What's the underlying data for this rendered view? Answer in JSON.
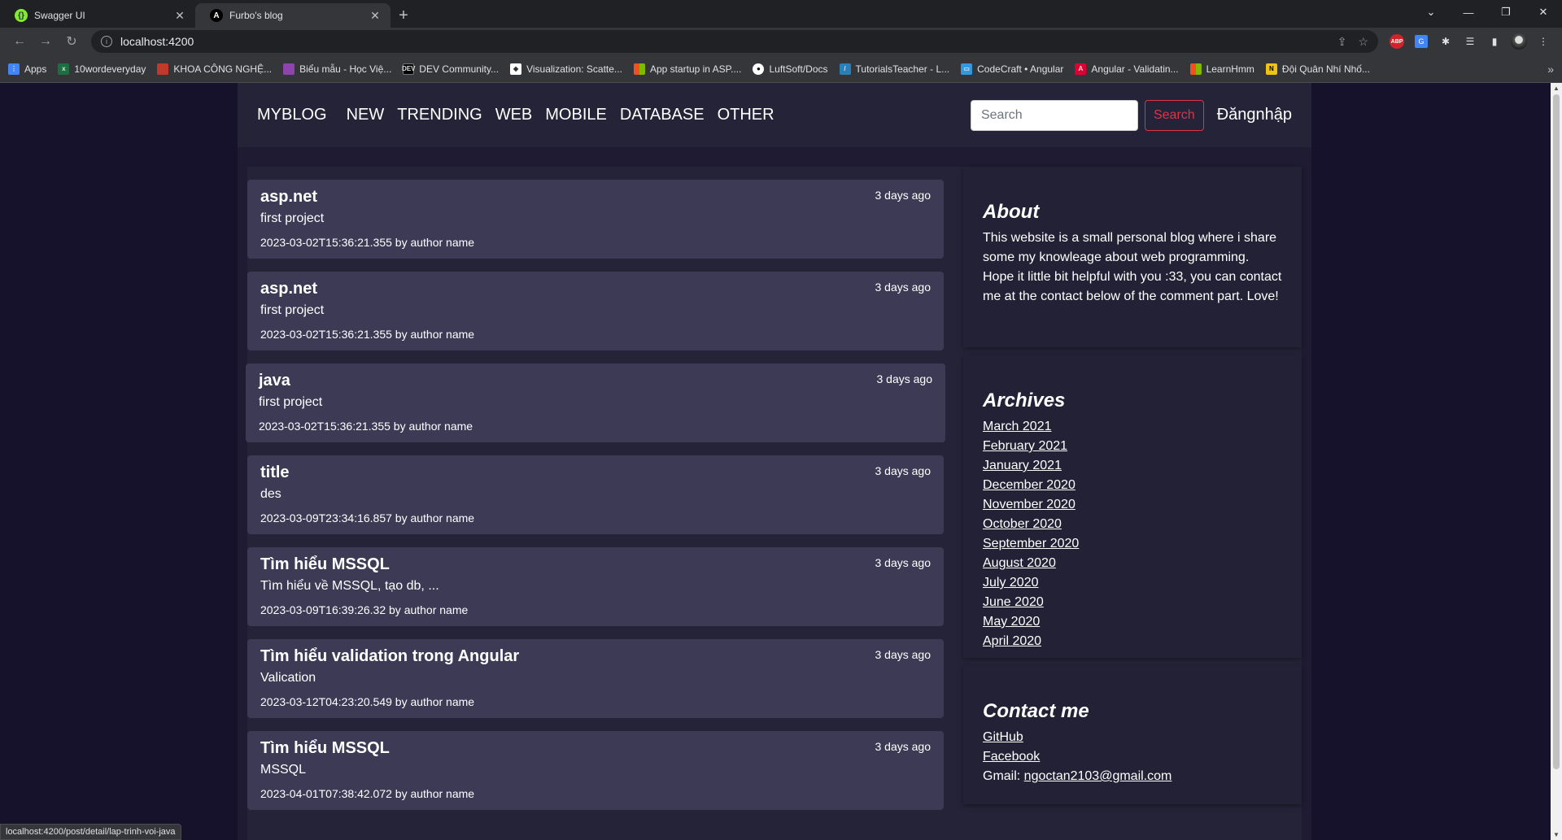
{
  "browser": {
    "tabs": [
      {
        "title": "Swagger UI",
        "favicon": "swagger-icon",
        "color": "#85ea2d"
      },
      {
        "title": "Furbo's blog",
        "favicon": "angular-icon",
        "color": "#ffffff"
      }
    ],
    "url": "localhost:4200",
    "bookmarks": [
      {
        "label": "Apps",
        "icon": "apps-icon",
        "color": "#4285f4"
      },
      {
        "label": "10wordeveryday",
        "icon": "excel-icon",
        "color": "#1d6f42"
      },
      {
        "label": "KHOA CÔNG NGHỆ...",
        "icon": "site-icon",
        "color": "#c0392b"
      },
      {
        "label": "Biểu mẫu - Học Việ...",
        "icon": "site-icon",
        "color": "#8e44ad"
      },
      {
        "label": "DEV Community...",
        "icon": "dev-icon",
        "color": "#000000"
      },
      {
        "label": "Visualization: Scatte...",
        "icon": "chart-icon",
        "color": "#ffffff"
      },
      {
        "label": "App startup in ASP....",
        "icon": "ms-icon",
        "color": "#f25022"
      },
      {
        "label": "LuftSoft/Docs",
        "icon": "github-icon",
        "color": "#ffffff"
      },
      {
        "label": "TutorialsTeacher - L...",
        "icon": "tt-icon",
        "color": "#2980b9"
      },
      {
        "label": "CodeCraft • Angular",
        "icon": "codecraft-icon",
        "color": "#3498db"
      },
      {
        "label": "Angular - Validatin...",
        "icon": "angular-icon",
        "color": "#dd0031"
      },
      {
        "label": "LearnHmm",
        "icon": "ms-icon",
        "color": "#f25022"
      },
      {
        "label": "Đội Quân Nhí Nhố...",
        "icon": "n-icon",
        "color": "#f1c40f"
      }
    ],
    "status_url": "localhost:4200/post/detail/lap-trinh-voi-java"
  },
  "nav": {
    "brand": "MYBLOG",
    "links": [
      "NEW",
      "TRENDING",
      "WEB",
      "MOBILE",
      "DATABASE",
      "OTHER"
    ],
    "search_placeholder": "Search",
    "search_button": "Search",
    "login": "Đăngnhập"
  },
  "posts": [
    {
      "title": "asp.net",
      "description": "first project",
      "meta": "2023-03-02T15:36:21.355 by author name",
      "ago": "3 days ago"
    },
    {
      "title": "asp.net",
      "description": "first project",
      "meta": "2023-03-02T15:36:21.355 by author name",
      "ago": "3 days ago"
    },
    {
      "title": "java",
      "description": "first project",
      "meta": "2023-03-02T15:36:21.355 by author name",
      "ago": "3 days ago"
    },
    {
      "title": "title",
      "description": "des",
      "meta": "2023-03-09T23:34:16.857 by author name",
      "ago": "3 days ago"
    },
    {
      "title": "Tìm hiểu MSSQL",
      "description": "Tìm hiểu về MSSQL, tạo db, ...",
      "meta": "2023-03-09T16:39:26.32 by author name",
      "ago": "3 days ago"
    },
    {
      "title": "Tìm hiểu validation trong Angular",
      "description": "Valication",
      "meta": "2023-03-12T04:23:20.549 by author name",
      "ago": "3 days ago"
    },
    {
      "title": "Tìm hiểu MSSQL",
      "description": "MSSQL",
      "meta": "2023-04-01T07:38:42.072 by author name",
      "ago": "3 days ago"
    }
  ],
  "about": {
    "heading": "About",
    "text": "This website is a small personal blog where i share some my knowleage about web programming. Hope it little bit helpful with you :33, you can contact me at the contact below of the comment part. Love!"
  },
  "archives": {
    "heading": "Archives",
    "items": [
      "March 2021",
      "February 2021",
      "January 2021",
      "December 2020",
      "November 2020",
      "October 2020",
      "September 2020",
      "August 2020",
      "July 2020",
      "June 2020",
      "May 2020",
      "April 2020"
    ]
  },
  "contact": {
    "heading": "Contact me",
    "github": "GitHub",
    "facebook": "Facebook",
    "gmail_label": "Gmail: ",
    "gmail": "ngoctan2103@gmail.com"
  }
}
